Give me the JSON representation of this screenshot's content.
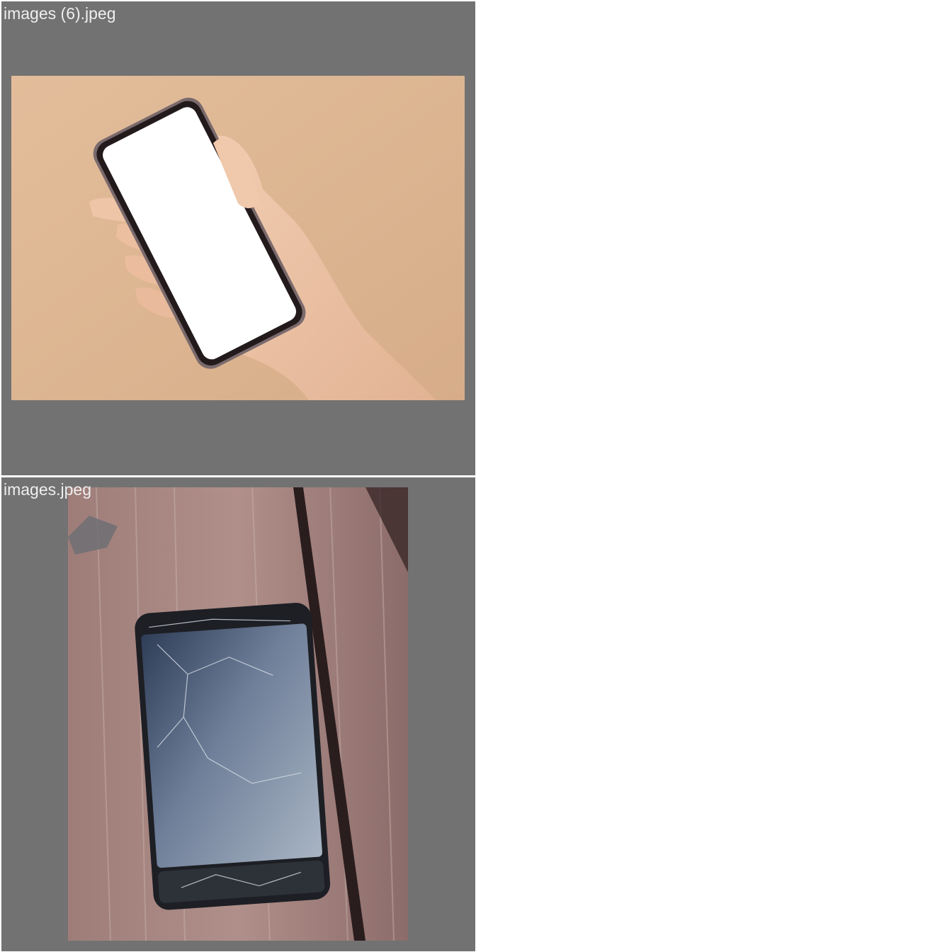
{
  "tiles": [
    {
      "filename": "images (6).jpeg"
    },
    {
      "filename": "images.jpeg"
    }
  ],
  "colors": {
    "tile_background": "#727272",
    "page_background": "#ffffff",
    "caption_text": "#eeeeee"
  }
}
